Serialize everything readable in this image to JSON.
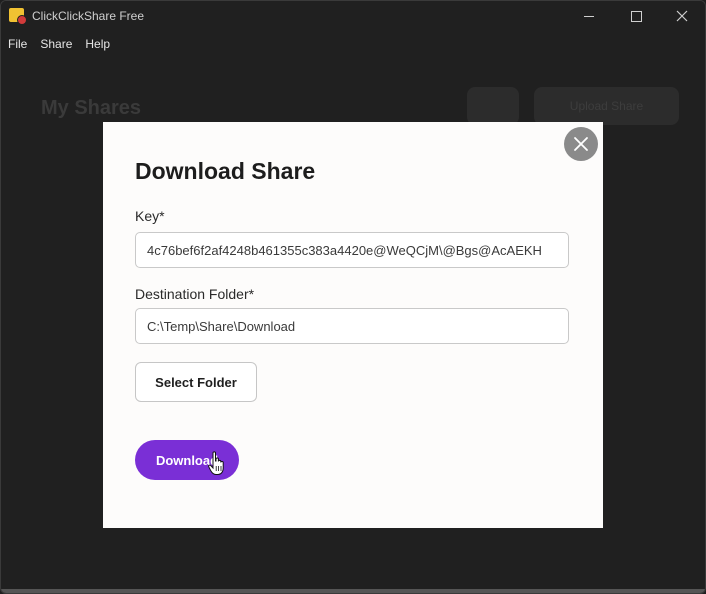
{
  "window": {
    "title": "ClickClickShare Free"
  },
  "menu": {
    "items": [
      "File",
      "Share",
      "Help"
    ]
  },
  "background": {
    "heading": "My Shares",
    "button_label": "Upload Share"
  },
  "modal": {
    "title": "Download Share",
    "key_label": "Key*",
    "key_value": "4c76bef6f2af4248b461355c383a4420e@WeQCjM\\@Bgs@AcAEKH",
    "dest_label": "Destination Folder*",
    "dest_value": "C:\\Temp\\Share\\Download",
    "select_folder_label": "Select Folder",
    "download_label": "Download"
  },
  "colors": {
    "accent": "#7a2fd6",
    "modal_bg": "#fdfcfb",
    "overlay": "#202020"
  }
}
